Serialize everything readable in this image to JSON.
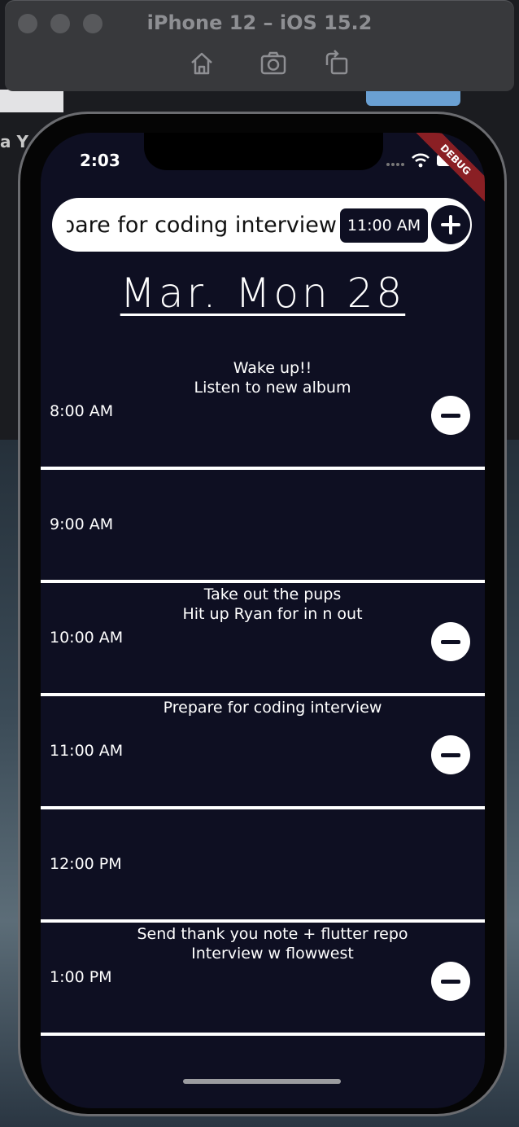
{
  "window": {
    "title": "iPhone 12 – iOS 15.2",
    "toolbar": [
      "home-icon",
      "screenshot-icon",
      "rotate-icon"
    ]
  },
  "desktop": {
    "partial_text": "a Y"
  },
  "status_bar": {
    "time": "2:03",
    "debug_label": "DEBUG"
  },
  "input_bar": {
    "task_value": "Prepare for coding interview",
    "time_value": "11:00 AM",
    "add_icon": "plus-icon"
  },
  "date_heading": "Mar. Mon 28",
  "schedule": [
    {
      "time": "8:00 AM",
      "tasks": [
        "Wake up!!",
        "Listen to new album"
      ],
      "has_remove": true
    },
    {
      "time": "9:00 AM",
      "tasks": [],
      "has_remove": false
    },
    {
      "time": "10:00 AM",
      "tasks": [
        "Take out the pups",
        "Hit up Ryan for in n out"
      ],
      "has_remove": true
    },
    {
      "time": "11:00 AM",
      "tasks": [
        "Prepare for coding interview"
      ],
      "has_remove": true
    },
    {
      "time": "12:00 PM",
      "tasks": [],
      "has_remove": false
    },
    {
      "time": "1:00 PM",
      "tasks": [
        "Send thank you note + flutter repo",
        "Interview w flowwest"
      ],
      "has_remove": true
    }
  ],
  "colors": {
    "screen_background": "#0e0f22",
    "accent": "#ffffff",
    "debug_banner": "#8a1f24"
  }
}
